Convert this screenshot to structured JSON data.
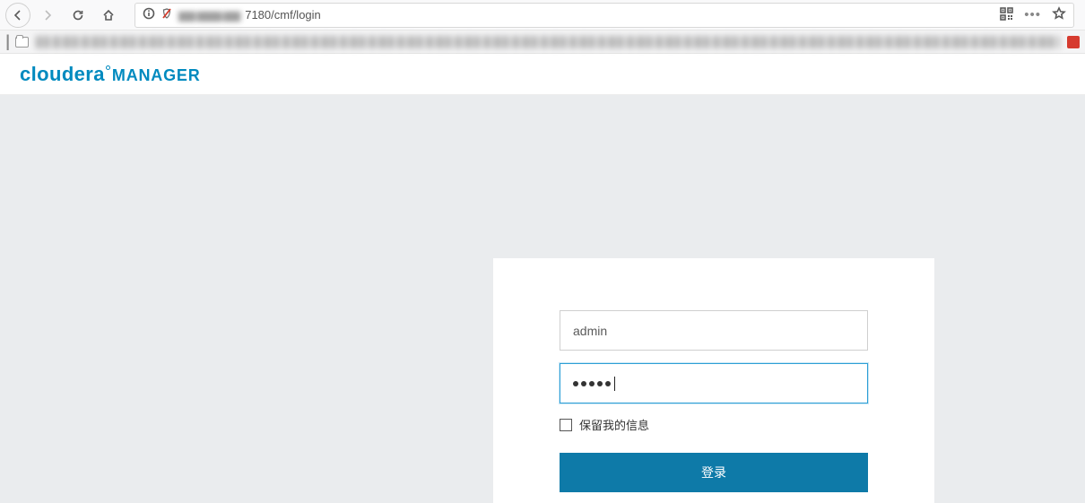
{
  "browser": {
    "url_prefix_blur": "▆▆ ▆▆▆.▆▆",
    "url_visible": "7180/cmf/login"
  },
  "header": {
    "logo_brand": "cloudera",
    "logo_product": "MANAGER"
  },
  "login": {
    "username_value": "admin",
    "password_dot_count": 5,
    "remember_label": "保留我的信息",
    "submit_label": "登录"
  }
}
